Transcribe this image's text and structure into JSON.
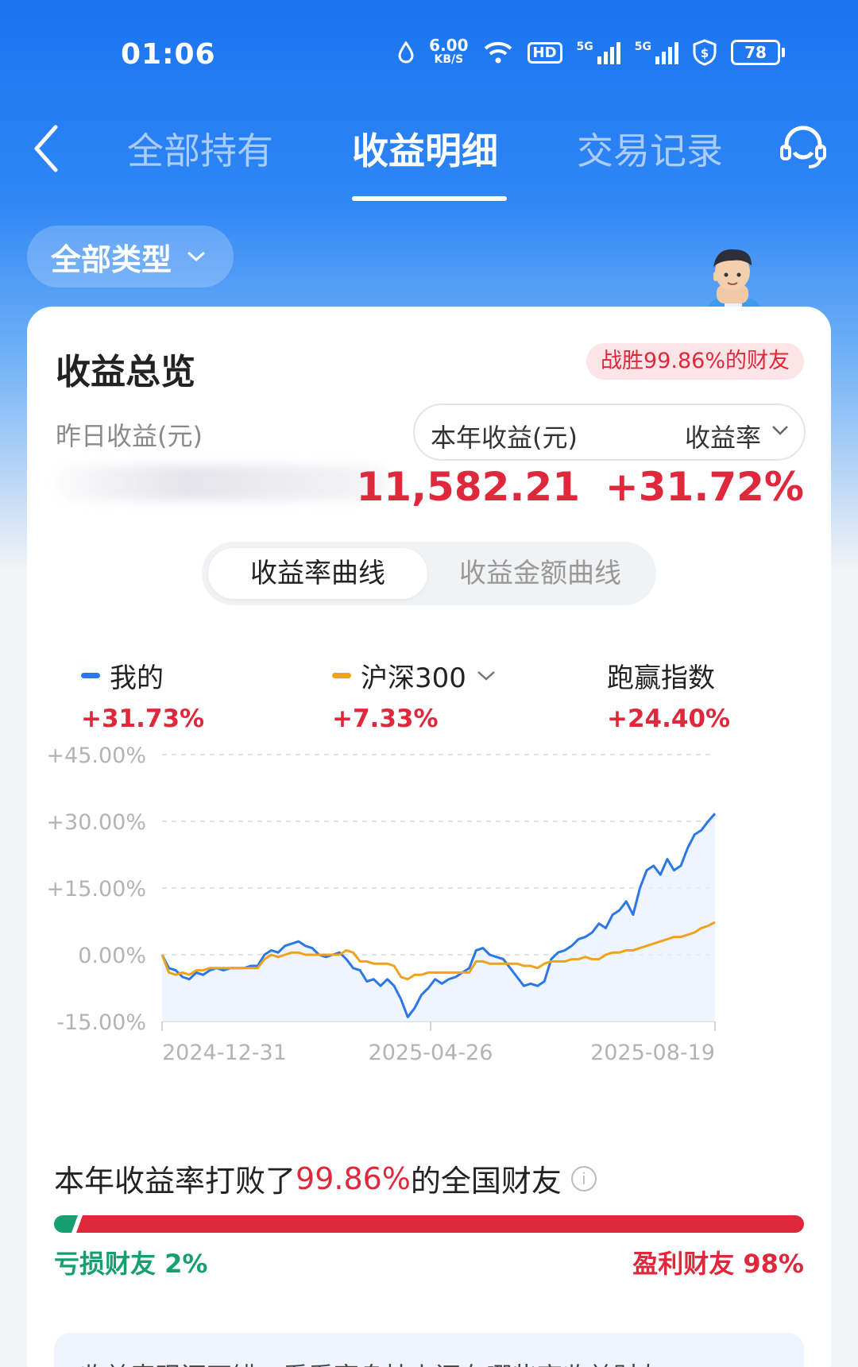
{
  "status": {
    "time": "01:06",
    "net_speed": "6.00",
    "net_unit": "KB/S",
    "hd": "HD",
    "sig1": "5G",
    "sig2": "5G",
    "battery": "78"
  },
  "nav": {
    "tabs": [
      "全部持有",
      "收益明细",
      "交易记录"
    ],
    "active_tab": "收益明细"
  },
  "filter": {
    "label": "全部类型"
  },
  "overview": {
    "title": "收益总览",
    "win_badge": "战胜99.86%的财友",
    "yesterday_label": "昨日收益(元)",
    "metric_left": "本年收益(元)",
    "metric_right": "收益率",
    "year_profit": "11,582.21",
    "year_rate": "+31.72%"
  },
  "segment": {
    "active": "收益率曲线",
    "inactive": "收益金额曲线"
  },
  "legend": {
    "mine_name": "我的",
    "mine_value": "+31.73%",
    "bench_name": "沪深300",
    "bench_value": "+7.33%",
    "beat_name": "跑赢指数",
    "beat_value": "+24.40%"
  },
  "chart_data": {
    "type": "line",
    "y_ticks": [
      "+45.00%",
      "+30.00%",
      "+15.00%",
      "0.00%",
      "-15.00%"
    ],
    "ylim": [
      -15,
      45
    ],
    "x_ticks": [
      "2024-12-31",
      "2025-04-26",
      "2025-08-19"
    ],
    "grid": true,
    "colors": {
      "mine": "#2b78e4",
      "bench": "#f0a21c"
    },
    "series": [
      {
        "name": "我的",
        "values": [
          0,
          -3,
          -3.5,
          -5,
          -5.5,
          -4,
          -4.5,
          -3.5,
          -3,
          -3.5,
          -3,
          -3,
          -3,
          -2.5,
          -2.5,
          0,
          1,
          0.5,
          2,
          2.5,
          3,
          2,
          1.5,
          0,
          -0.5,
          0,
          0.5,
          -1,
          -3,
          -3.5,
          -6,
          -5.5,
          -7,
          -5.5,
          -7,
          -10,
          -14,
          -12,
          -9,
          -7.5,
          -5.5,
          -6.5,
          -5.5,
          -5,
          -4,
          -3,
          1,
          1.5,
          0,
          -0.5,
          -1,
          -3,
          -5,
          -7,
          -6.5,
          -7,
          -6,
          -1,
          0.5,
          1,
          2,
          3.5,
          4,
          5,
          7,
          6,
          9,
          10,
          12,
          9,
          15,
          19,
          20,
          18,
          21.5,
          19,
          20,
          24,
          27,
          28,
          30,
          31.73
        ]
      },
      {
        "name": "沪深300",
        "values": [
          0,
          -4,
          -4.5,
          -4,
          -4.5,
          -3.5,
          -3.5,
          -3,
          -3,
          -3,
          -3,
          -3,
          -3,
          -3,
          -3,
          -1,
          0,
          -0.5,
          0,
          0.5,
          0.5,
          0,
          0,
          0,
          0,
          0,
          0,
          1,
          0.5,
          -1.5,
          -1.5,
          -2,
          -2,
          -2,
          -2.5,
          -5,
          -5.5,
          -4.5,
          -4.5,
          -4,
          -4,
          -4,
          -4,
          -4,
          -4,
          -4,
          -1.5,
          -1.5,
          -2,
          -2,
          -2,
          -2,
          -2,
          -2.5,
          -2.5,
          -3,
          -2,
          -1.5,
          -1.5,
          -1.5,
          -1,
          -1,
          -0.5,
          -1,
          -1,
          0,
          0.5,
          0.5,
          1,
          1,
          1.5,
          2,
          2.5,
          3,
          3.5,
          4,
          4,
          4.5,
          5,
          6,
          6.5,
          7.33
        ]
      }
    ]
  },
  "beat": {
    "prefix": "本年收益率打败了",
    "pct": "99.86%",
    "suffix": "的全国财友",
    "loss_label": "亏损财友 2%",
    "profit_label": "盈利财友 98%",
    "loss_share": 2,
    "profit_share": 98
  },
  "tip": {
    "text": "收益表现还不错，看看享身挂上还有哪些高收益财友"
  }
}
